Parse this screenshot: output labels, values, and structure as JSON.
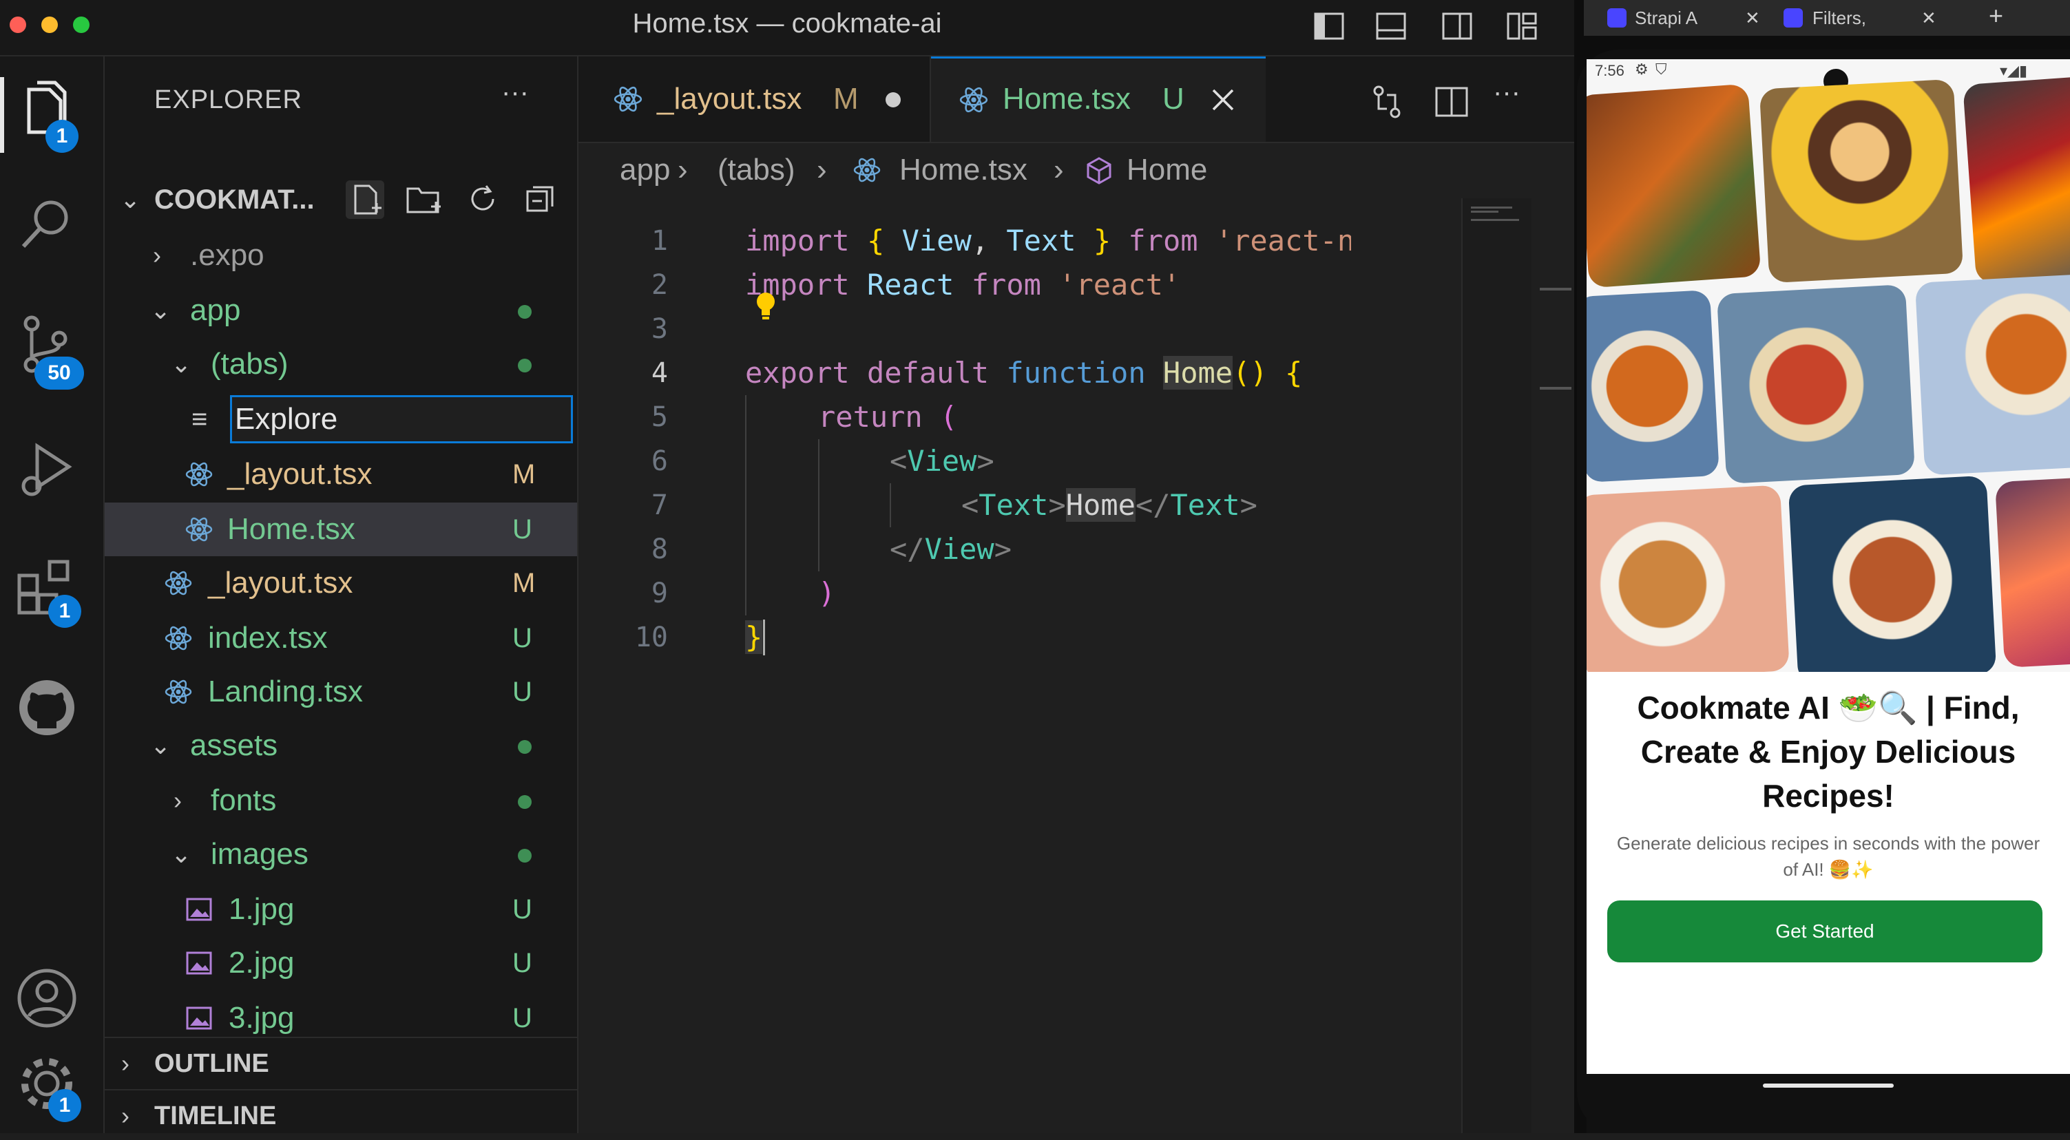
{
  "window": {
    "title": "Home.tsx — cookmate-ai"
  },
  "activity_bar": {
    "explorer_badge": "1",
    "source_control_badge": "50",
    "extensions_badge": "1",
    "settings_badge": "1"
  },
  "explorer": {
    "header": "EXPLORER",
    "more": "···",
    "project": "COOKMAT...",
    "rename_input_value": "Explore",
    "items": [
      {
        "label": ".expo",
        "status": ""
      },
      {
        "label": "app",
        "status": ""
      },
      {
        "label": "(tabs)",
        "status": ""
      },
      {
        "label": "_layout.tsx",
        "status": "M"
      },
      {
        "label": "Home.tsx",
        "status": "U"
      },
      {
        "label": "_layout.tsx",
        "status": "M"
      },
      {
        "label": "index.tsx",
        "status": "U"
      },
      {
        "label": "Landing.tsx",
        "status": "U"
      },
      {
        "label": "assets",
        "status": ""
      },
      {
        "label": "fonts",
        "status": ""
      },
      {
        "label": "images",
        "status": ""
      },
      {
        "label": "1.jpg",
        "status": "U"
      },
      {
        "label": "2.jpg",
        "status": "U"
      },
      {
        "label": "3.jpg",
        "status": "U"
      }
    ],
    "outline": "OUTLINE",
    "timeline": "TIMELINE"
  },
  "tabs": [
    {
      "label": "_layout.tsx",
      "status": "M"
    },
    {
      "label": "Home.tsx",
      "status": "U"
    }
  ],
  "breadcrumb": [
    "app",
    "(tabs)",
    "Home.tsx",
    "Home"
  ],
  "code": {
    "line_numbers": [
      "1",
      "2",
      "3",
      "4",
      "5",
      "6",
      "7",
      "8",
      "9",
      "10"
    ],
    "l1": {
      "import": "import",
      "ob": "{",
      "view": "View",
      "comma": ",",
      "text": "Text",
      "cb": "}",
      "from": "from",
      "str": "'react-native"
    },
    "l2": {
      "import": "import",
      "react": "React",
      "from": "from",
      "str": "'react'"
    },
    "l4": {
      "export": "export",
      "default": "default",
      "function": "function",
      "name": "Home",
      "parens": "()",
      "brace": "{"
    },
    "l5": {
      "return": "return",
      "paren": "("
    },
    "l6": {
      "open": "<",
      "tag": "View",
      "close": ">"
    },
    "l7": {
      "open": "<",
      "tag": "Text",
      "close": ">",
      "text": "Home",
      "open2": "</",
      "tag2": "Text",
      "close2": ">"
    },
    "l8": {
      "open": "</",
      "tag": "View",
      "close": ">"
    },
    "l9": {
      "paren": ")"
    },
    "l10": {
      "brace": "}"
    }
  },
  "browser_tabs": [
    {
      "label": "Strapi A"
    },
    {
      "label": "Filters,"
    }
  ],
  "phone": {
    "status_time": "7:56",
    "heading": "Cookmate AI 🥗🔍 | Find, Create & Enjoy Delicious Recipes!",
    "subtext": "Generate delicious recipes in seconds with the power of AI! 🍔✨",
    "cta": "Get Started"
  },
  "colors": {
    "accent": "#0a7bd8",
    "untracked": "#73c991",
    "modified": "#e2c08d",
    "cta": "#16893a"
  }
}
